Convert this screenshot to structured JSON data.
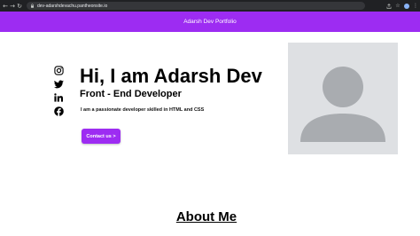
{
  "browser": {
    "url": "dev-adarshdevachu.pantheonsite.io",
    "icons": [
      "back-icon",
      "forward-icon",
      "reload-icon",
      "lock-icon",
      "share-icon",
      "bookmark-star-icon",
      "profile-icon"
    ]
  },
  "header": {
    "brand": "Adarsh Dev Portfolio"
  },
  "social": {
    "icons": [
      "instagram-icon",
      "twitter-icon",
      "linkedin-icon",
      "facebook-icon"
    ]
  },
  "hero": {
    "title": "Hi, I am Adarsh Dev",
    "subtitle": "Front - End Developer",
    "description": "I am a passionate developer skilled in HTML and CSS",
    "cta_label": "Contact us >"
  },
  "about": {
    "title": "About Me"
  },
  "colors": {
    "accent": "#9d2cf2",
    "avatar_bg": "#dee0e3",
    "avatar_fg": "#a9acb0",
    "chrome": "#202124"
  }
}
